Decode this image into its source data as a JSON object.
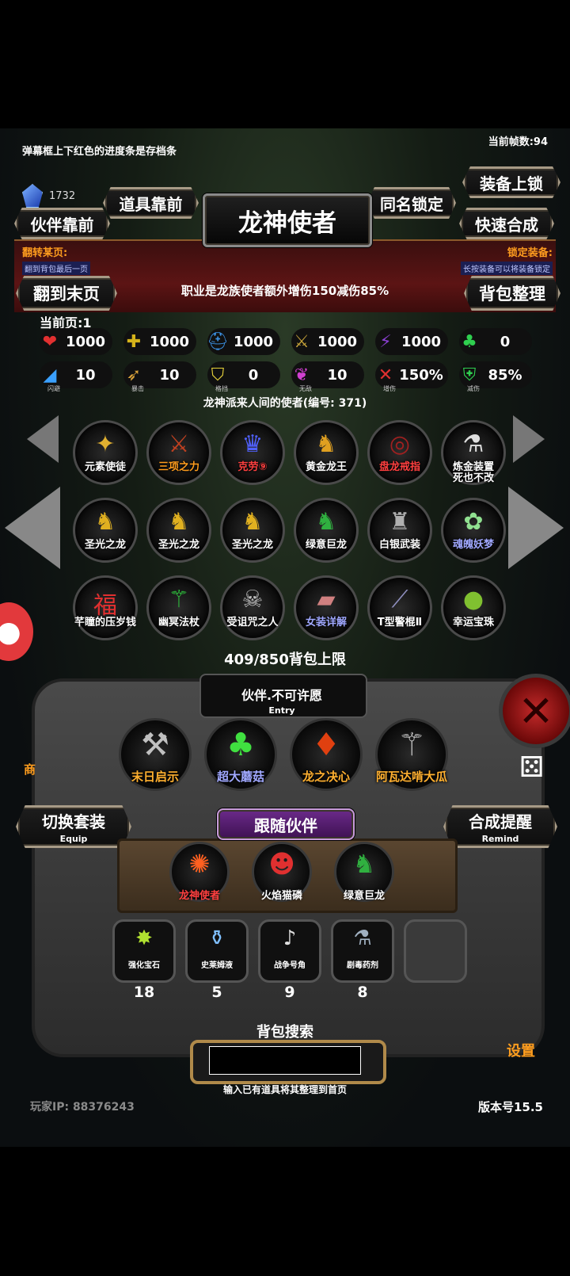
{
  "hud": {
    "hint": "弹幕框上下红色的进度条是存档条",
    "fps": "当前帧数:94",
    "gems": "1732"
  },
  "title": "龙神使者",
  "buttons": {
    "items_front": "道具靠前",
    "partner_front": "伙伴靠前",
    "same_name_lock": "同名锁定",
    "equip_lock": "装备上锁",
    "quick_merge": "快速合成",
    "flip_last": "翻到末页",
    "bag_sort": "背包整理"
  },
  "banner": {
    "flip_label": "翻转某页:",
    "flip_sub": "翻到背包最后一页",
    "lock_label": "锁定装备:",
    "lock_sub": "长按装备可以将装备锁定",
    "job_desc": "职业是龙族使者额外增伤150减伤85%"
  },
  "current_page": "当前页:1",
  "stats_row1": [
    {
      "icon": "heart-icon",
      "glyph": "❤",
      "color": "#e23030",
      "value": "1000"
    },
    {
      "icon": "armor-icon",
      "glyph": "✚",
      "color": "#d4b21a",
      "value": "1000"
    },
    {
      "icon": "helmet-icon",
      "glyph": "⛑",
      "color": "#3b8fe0",
      "value": "1000"
    },
    {
      "icon": "sword-icon",
      "glyph": "⚔",
      "color": "#c8a43a",
      "value": "1000"
    },
    {
      "icon": "lightning-icon",
      "glyph": "⚡",
      "color": "#8a3fd0",
      "value": "1000"
    },
    {
      "icon": "clover-icon",
      "glyph": "♣",
      "color": "#2fcf4f",
      "value": "0"
    }
  ],
  "stats_row2": [
    {
      "icon": "boot-icon",
      "glyph": "◢",
      "color": "#3aa0ff",
      "value": "10",
      "cap": "闪避"
    },
    {
      "icon": "crit-icon",
      "glyph": "➶",
      "color": "#d9a23a",
      "value": "10",
      "cap": "暴击"
    },
    {
      "icon": "shield-icon",
      "glyph": "⛉",
      "color": "#e6d23a",
      "value": "0",
      "cap": "格挡"
    },
    {
      "icon": "wings-icon",
      "glyph": "❦",
      "color": "#d040d0",
      "value": "10",
      "cap": "无敌"
    },
    {
      "icon": "crossed-swords-icon",
      "glyph": "✕",
      "color": "#e03030",
      "value": "150%",
      "cap": "增伤"
    },
    {
      "icon": "guard-icon",
      "glyph": "⛨",
      "color": "#2fcf4f",
      "value": "85%",
      "cap": "减伤"
    }
  ],
  "desc": "龙神派来人间的使者(编号:  371)",
  "grid": [
    {
      "name": "元素使徒",
      "glyph": "✦",
      "color": "#e0b030",
      "name_color": "#ffffff"
    },
    {
      "name": "三项之力",
      "glyph": "⚔",
      "color": "#c04020",
      "name_color": "#ff9d1e"
    },
    {
      "name": "克劳⑨",
      "glyph": "♛",
      "color": "#5060ff",
      "name_color": "#ff4040"
    },
    {
      "name": "黄金龙王",
      "glyph": "♞",
      "color": "#e0a020",
      "name_color": "#ffffff"
    },
    {
      "name": "盘龙戒指",
      "glyph": "◎",
      "color": "#a02020",
      "name_color": "#ff4040"
    },
    {
      "name": "炼金装置\n死也不改",
      "glyph": "⚗",
      "color": "#e0e0e0",
      "name_color": "#ffffff"
    },
    {
      "name": "圣光之龙",
      "glyph": "♞",
      "color": "#e0b020",
      "name_color": "#ffffff"
    },
    {
      "name": "圣光之龙",
      "glyph": "♞",
      "color": "#e0b020",
      "name_color": "#ffffff"
    },
    {
      "name": "圣光之龙",
      "glyph": "♞",
      "color": "#e0b020",
      "name_color": "#ffffff"
    },
    {
      "name": "绿意巨龙",
      "glyph": "♞",
      "color": "#30b040",
      "name_color": "#ffffff"
    },
    {
      "name": "白银武装",
      "glyph": "♜",
      "color": "#b0b0b0",
      "name_color": "#ffffff"
    },
    {
      "name": "魂魄妖梦",
      "glyph": "✿",
      "color": "#90e090",
      "name_color": "#a0a8ff"
    },
    {
      "name": "芊瞳的压岁钱",
      "glyph": "福",
      "color": "#e03030",
      "name_color": "#ffffff"
    },
    {
      "name": "幽冥法杖",
      "glyph": "⚚",
      "color": "#30d040",
      "name_color": "#ffffff"
    },
    {
      "name": "受诅咒之人",
      "glyph": "☠",
      "color": "#c0c0c0",
      "name_color": "#ffffff"
    },
    {
      "name": "女装详解",
      "glyph": "▰",
      "color": "#d08080",
      "name_color": "#a0a8ff"
    },
    {
      "name": "T型警棍Ⅱ",
      "glyph": "⟋",
      "color": "#9090c0",
      "name_color": "#ffffff"
    },
    {
      "name": "幸运宝珠",
      "glyph": "●",
      "color": "#80c030",
      "name_color": "#ffffff"
    }
  ],
  "bag_limit": "409/850背包上限",
  "entry": {
    "title": "伙伴.不可许愿",
    "sub": "Entry"
  },
  "equip": [
    {
      "name": "末日启示",
      "glyph": "⚒",
      "color": "#c0c0c0",
      "name_color": "#ffb030"
    },
    {
      "name": "超大蘑菇",
      "glyph": "♣",
      "color": "#40e040",
      "name_color": "#a0a8ff"
    },
    {
      "name": "龙之决心",
      "glyph": "♦",
      "color": "#e04010",
      "name_color": "#ffb030"
    },
    {
      "name": "阿瓦达啃大瓜",
      "glyph": "⚚",
      "color": "#c0c0c0",
      "name_color": "#ffb030"
    }
  ],
  "switch_btn": {
    "label": "切换套装",
    "sub": "Equip"
  },
  "remind_btn": {
    "label": "合成提醒",
    "sub": "Remind"
  },
  "follow_label": "跟随伙伴",
  "partners": [
    {
      "name": "龙神使者",
      "glyph": "✺",
      "color": "#ff6020",
      "name_color": "#ff4040"
    },
    {
      "name": "火焰猫磷",
      "glyph": "☻",
      "color": "#e03030",
      "name_color": "#ffffff"
    },
    {
      "name": "绿意巨龙",
      "glyph": "♞",
      "color": "#30b040",
      "name_color": "#ffffff"
    }
  ],
  "slots": [
    {
      "name": "强化宝石",
      "count": "18",
      "glyph": "✸",
      "color": "#b0e030"
    },
    {
      "name": "史莱姆液",
      "count": "5",
      "glyph": "⚱",
      "color": "#80c0ff"
    },
    {
      "name": "战争号角",
      "count": "9",
      "glyph": "♪",
      "color": "#e0e0e0"
    },
    {
      "name": "剧毒药剂",
      "count": "8",
      "glyph": "⚗",
      "color": "#a0b0c0"
    }
  ],
  "search": {
    "label": "背包搜索",
    "placeholder": "",
    "hint": "输入已有道具将其整理到首页"
  },
  "settings": "设置",
  "shop": "商",
  "player_ip": "玩家IP:  88376243",
  "version": "版本号15.5"
}
